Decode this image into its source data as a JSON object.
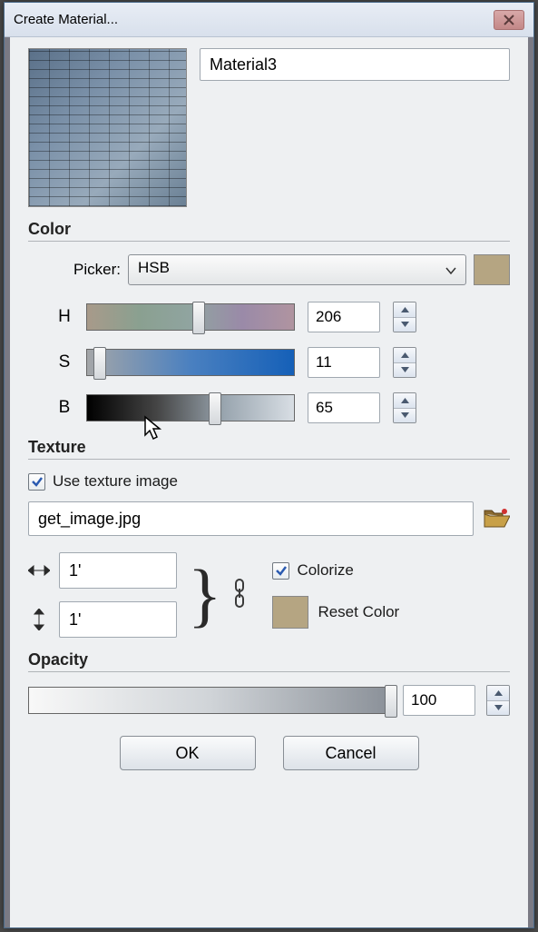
{
  "window": {
    "title": "Create Material..."
  },
  "material": {
    "name": "Material3"
  },
  "color": {
    "heading": "Color",
    "picker_label": "Picker:",
    "picker_value": "HSB",
    "swatch": "#b5a582",
    "h": {
      "label": "H",
      "value": "206",
      "thumb_pct": 54
    },
    "s": {
      "label": "S",
      "value": "11",
      "thumb_pct": 6
    },
    "b": {
      "label": "B",
      "value": "65",
      "thumb_pct": 62
    }
  },
  "texture": {
    "heading": "Texture",
    "use_label": "Use texture image",
    "use_checked": true,
    "file": "get_image.jpg",
    "width": "1'",
    "height": "1'",
    "colorize_label": "Colorize",
    "colorize_checked": true,
    "reset_label": "Reset Color"
  },
  "opacity": {
    "heading": "Opacity",
    "value": "100",
    "thumb_pct": 100
  },
  "buttons": {
    "ok": "OK",
    "cancel": "Cancel"
  }
}
